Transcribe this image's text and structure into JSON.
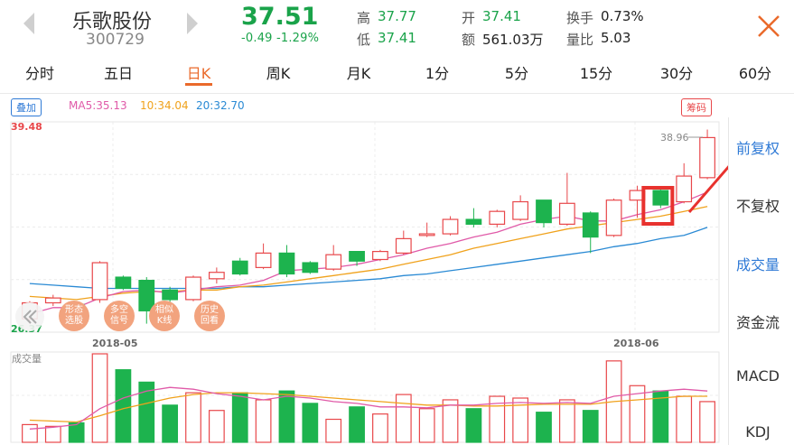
{
  "header": {
    "name": "乐歌股份",
    "code": "300729",
    "price": "37.51",
    "change": "-0.49  -1.29%",
    "high_label": "高",
    "high": "37.77",
    "low_label": "低",
    "low": "37.41",
    "open_label": "开",
    "open": "37.41",
    "amount_label": "额",
    "amount": "561.03万",
    "turnover_label": "换手",
    "turnover": "0.73%",
    "volratio_label": "量比",
    "volratio": "5.03"
  },
  "tabs": [
    "分时",
    "五日",
    "日K",
    "周K",
    "月K",
    "1分",
    "5分",
    "15分",
    "30分",
    "60分"
  ],
  "active_tab": "日K",
  "legend": {
    "overlay_button": "叠加",
    "ma5": "MA5:35.13",
    "ma10": "10:34.04",
    "ma20": "20:32.70",
    "chips_button": "筹码"
  },
  "side_menu": [
    "前复权",
    "不复权",
    "成交量",
    "资金流",
    "MACD",
    "KDJ"
  ],
  "pills": [
    {
      "l1": "形态",
      "l2": "选股"
    },
    {
      "l1": "多空",
      "l2": "信号"
    },
    {
      "l1": "相似",
      "l2": "K线"
    },
    {
      "l1": "历史",
      "l2": "回看"
    }
  ],
  "volume_title": "成交量",
  "colors": {
    "up": "#e8474a",
    "down": "#1db34e",
    "accent": "#ea6a2b",
    "ma5": "#e05aa8",
    "ma10": "#f0a21c",
    "ma20": "#2a8ad4"
  },
  "chart_data": {
    "type": "candlestick",
    "y_max_label": "39.48",
    "y_min_label": "26.37",
    "peak_label": "38.96",
    "ylim": [
      26.37,
      39.48
    ],
    "x_labels": [
      "2018-05",
      "2018-06"
    ],
    "candles": [
      {
        "o": 27.2,
        "c": 28.2,
        "h": 28.3,
        "l": 26.9
      },
      {
        "o": 28.2,
        "c": 28.5,
        "h": 28.7,
        "l": 28.0
      },
      {
        "o": 28.1,
        "c": 27.9,
        "h": 28.2,
        "l": 27.8
      },
      {
        "o": 28.4,
        "c": 30.7,
        "h": 30.8,
        "l": 28.2
      },
      {
        "o": 29.8,
        "c": 29.1,
        "h": 29.9,
        "l": 29.0
      },
      {
        "o": 29.6,
        "c": 27.7,
        "h": 29.8,
        "l": 26.9
      },
      {
        "o": 29.0,
        "c": 28.4,
        "h": 29.2,
        "l": 28.2
      },
      {
        "o": 28.4,
        "c": 29.8,
        "h": 29.9,
        "l": 28.3
      },
      {
        "o": 29.7,
        "c": 30.1,
        "h": 30.4,
        "l": 29.4
      },
      {
        "o": 30.8,
        "c": 30.0,
        "h": 31.0,
        "l": 29.9
      },
      {
        "o": 30.4,
        "c": 31.3,
        "h": 31.9,
        "l": 30.3
      },
      {
        "o": 31.3,
        "c": 30.0,
        "h": 31.8,
        "l": 29.8
      },
      {
        "o": 30.7,
        "c": 30.1,
        "h": 30.8,
        "l": 30.0
      },
      {
        "o": 30.3,
        "c": 31.2,
        "h": 31.8,
        "l": 30.2
      },
      {
        "o": 31.4,
        "c": 30.8,
        "h": 31.4,
        "l": 30.5
      },
      {
        "o": 30.9,
        "c": 31.4,
        "h": 31.5,
        "l": 30.8
      },
      {
        "o": 31.3,
        "c": 32.2,
        "h": 32.7,
        "l": 31.2
      },
      {
        "o": 32.4,
        "c": 32.5,
        "h": 33.2,
        "l": 32.3
      },
      {
        "o": 32.5,
        "c": 33.4,
        "h": 33.6,
        "l": 32.4
      },
      {
        "o": 33.4,
        "c": 33.1,
        "h": 34.1,
        "l": 32.9
      },
      {
        "o": 33.1,
        "c": 33.9,
        "h": 34.0,
        "l": 32.9
      },
      {
        "o": 33.4,
        "c": 34.5,
        "h": 34.9,
        "l": 33.3
      },
      {
        "o": 34.6,
        "c": 33.2,
        "h": 34.6,
        "l": 32.9
      },
      {
        "o": 33.1,
        "c": 34.4,
        "h": 36.3,
        "l": 33.0
      },
      {
        "o": 33.8,
        "c": 32.3,
        "h": 33.9,
        "l": 31.3
      },
      {
        "o": 32.4,
        "c": 34.6,
        "h": 34.7,
        "l": 32.3
      },
      {
        "o": 34.6,
        "c": 35.2,
        "h": 35.5,
        "l": 33.5
      },
      {
        "o": 35.2,
        "c": 34.3,
        "h": 35.3,
        "l": 34.1
      },
      {
        "o": 34.5,
        "c": 36.1,
        "h": 36.9,
        "l": 34.4
      },
      {
        "o": 36.0,
        "c": 38.5,
        "h": 39.0,
        "l": 35.9
      }
    ],
    "ma5": [
      27.5,
      27.9,
      27.9,
      28.5,
      28.9,
      29.0,
      28.8,
      29.0,
      29.2,
      29.3,
      29.6,
      30.2,
      30.3,
      30.4,
      30.6,
      30.9,
      31.2,
      31.6,
      31.9,
      32.3,
      32.6,
      33.1,
      33.4,
      33.6,
      33.3,
      33.3,
      33.7,
      34.0,
      34.5,
      35.1
    ],
    "ma10": [
      28.6,
      28.5,
      28.4,
      28.6,
      28.8,
      28.9,
      28.9,
      29.0,
      29.0,
      29.2,
      29.3,
      29.5,
      29.7,
      29.9,
      30.1,
      30.3,
      30.6,
      30.9,
      31.2,
      31.6,
      31.9,
      32.2,
      32.5,
      32.8,
      33.0,
      33.2,
      33.4,
      33.6,
      33.9,
      34.2
    ],
    "ma20": [
      29.4,
      29.3,
      29.2,
      29.1,
      29.1,
      29.1,
      29.1,
      29.1,
      29.1,
      29.2,
      29.2,
      29.3,
      29.4,
      29.5,
      29.6,
      29.7,
      29.9,
      30.0,
      30.2,
      30.4,
      30.6,
      30.8,
      31.0,
      31.2,
      31.4,
      31.7,
      31.9,
      32.2,
      32.4,
      32.9
    ],
    "volume": [
      20,
      18,
      22,
      100,
      82,
      68,
      42,
      56,
      36,
      56,
      48,
      58,
      44,
      26,
      40,
      32,
      54,
      38,
      48,
      38,
      52,
      50,
      34,
      48,
      36,
      92,
      64,
      58,
      52,
      46
    ],
    "vol_ma5": [
      15,
      17,
      20,
      38,
      50,
      58,
      62,
      60,
      55,
      52,
      48,
      52,
      50,
      46,
      44,
      40,
      40,
      39,
      42,
      42,
      44,
      45,
      44,
      45,
      44,
      52,
      55,
      58,
      60,
      58
    ],
    "vol_ma10": [
      25,
      24,
      23,
      30,
      38,
      44,
      50,
      54,
      56,
      56,
      55,
      54,
      52,
      50,
      48,
      46,
      44,
      42,
      42,
      41,
      41,
      42,
      43,
      43,
      43,
      46,
      48,
      50,
      52,
      52
    ]
  }
}
